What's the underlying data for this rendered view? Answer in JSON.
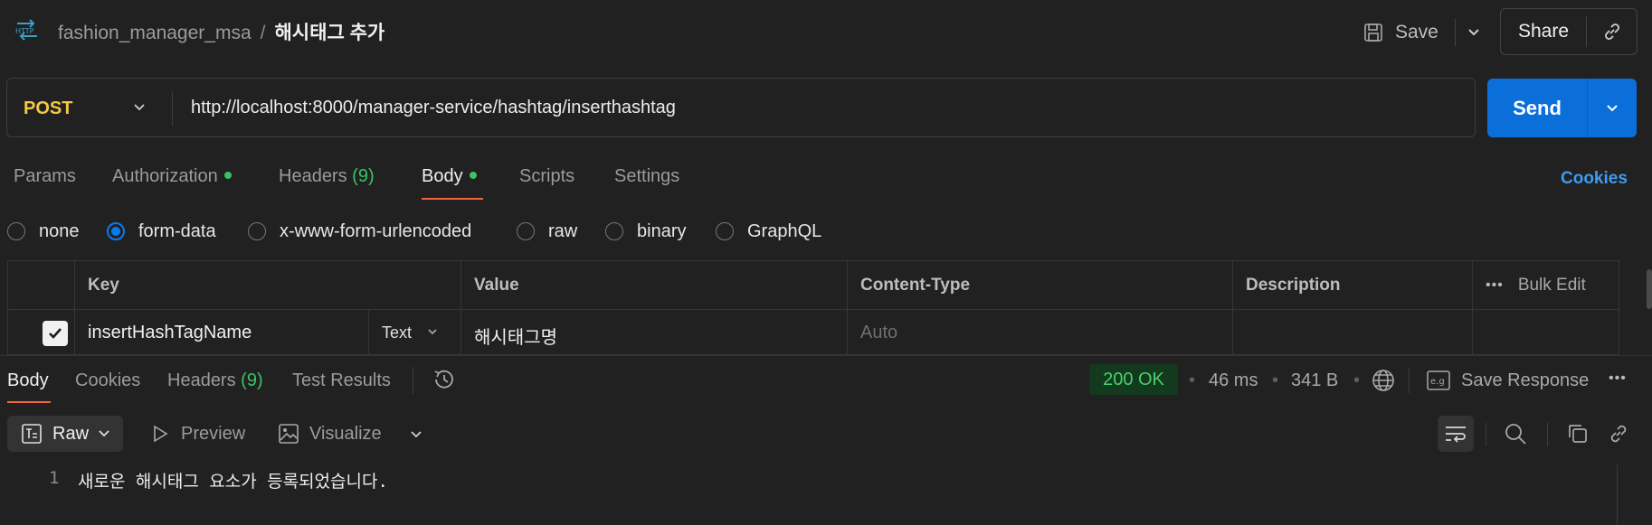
{
  "header": {
    "protocol_icon": "http-icon",
    "breadcrumb": {
      "collection": "fashion_manager_msa",
      "separator": "/",
      "request": "해시태그 추가"
    },
    "save_label": "Save",
    "share_label": "Share"
  },
  "request": {
    "method": "POST",
    "url": "http://localhost:8000/manager-service/hashtag/inserthashtag",
    "send_label": "Send"
  },
  "request_tabs": {
    "params": "Params",
    "authorization": "Authorization",
    "headers": "Headers",
    "headers_count": "(9)",
    "body": "Body",
    "scripts": "Scripts",
    "settings": "Settings",
    "cookies": "Cookies"
  },
  "body_types": {
    "none": "none",
    "form_data": "form-data",
    "urlencoded": "x-www-form-urlencoded",
    "raw": "raw",
    "binary": "binary",
    "graphql": "GraphQL",
    "selected": "form-data"
  },
  "form_table": {
    "headers": {
      "key": "Key",
      "value": "Value",
      "content_type": "Content-Type",
      "description": "Description",
      "bulk_edit": "Bulk Edit"
    },
    "rows": [
      {
        "checked": true,
        "key": "insertHashTagName",
        "type": "Text",
        "value": "해시태그명",
        "content_type": "Auto",
        "description": ""
      }
    ]
  },
  "response_tabs": {
    "body": "Body",
    "cookies": "Cookies",
    "headers": "Headers",
    "headers_count": "(9)",
    "test_results": "Test Results"
  },
  "response_meta": {
    "status": "200 OK",
    "time": "46 ms",
    "size": "341 B",
    "save_response": "Save Response"
  },
  "response_view": {
    "raw": "Raw",
    "preview": "Preview",
    "visualize": "Visualize"
  },
  "response_body": {
    "lines": [
      {
        "number": "1",
        "text": "새로운 해시태그 요소가 등록되었습니다."
      }
    ]
  },
  "colors": {
    "accent_blue": "#0b6fda",
    "method_post": "#f5c842",
    "status_green": "#47d16c",
    "tab_underline": "#f0663a"
  }
}
